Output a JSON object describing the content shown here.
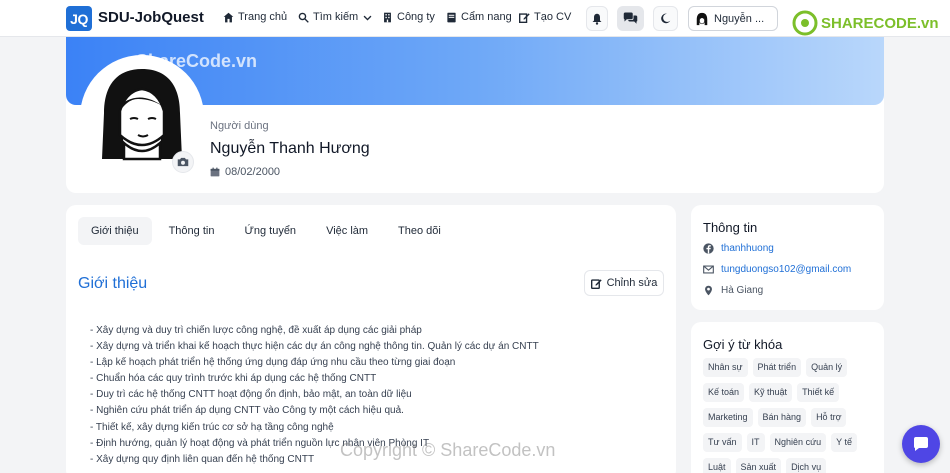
{
  "header": {
    "logo_text": "JQ",
    "brand": "SDU-JobQuest",
    "nav": [
      {
        "label": "Trang chủ",
        "icon": "home-icon"
      },
      {
        "label": "Tìm kiếm",
        "icon": "search-icon"
      },
      {
        "label": "Công ty",
        "icon": "building-icon"
      },
      {
        "label": "Cẩm nang",
        "icon": "book-icon"
      },
      {
        "label": "Tạo CV",
        "icon": "edit-icon"
      }
    ],
    "user_name": "Nguyễn ...",
    "watermark_logo": "SHARECODE.vn"
  },
  "profile": {
    "role": "Người dùng",
    "name": "Nguyễn Thanh Hương",
    "dob": "08/02/2000",
    "banner_watermark": "ShareCode.vn"
  },
  "tabs": [
    "Giới thiệu",
    "Thông tin",
    "Ứng tuyển",
    "Việc làm",
    "Theo dõi"
  ],
  "intro": {
    "title": "Giới thiệu",
    "edit_label": "Chỉnh sửa",
    "items": [
      "- Xây dựng và duy trì chiến lược công nghệ, đề xuất áp dụng các giải pháp",
      "- Xây dựng và triển khai kế hoạch thực hiện các dự án công nghệ thông tin. Quản lý các dự án CNTT",
      "- Lập kế hoạch phát triển hệ thống ứng dụng đáp ứng nhu cầu theo từng giai đoạn",
      "- Chuẩn hóa các quy trình trước khi áp dụng các hệ thống CNTT",
      "- Duy trì các hệ thống CNTT hoạt động ổn định, bảo mật, an toàn dữ liệu",
      "- Nghiên cứu phát triển áp dụng CNTT vào Công ty một cách hiệu quả.",
      "- Thiết kế, xây dựng kiến trúc cơ sở hạ tầng công nghệ",
      "- Định hướng, quản lý hoạt động và phát triển nguồn lực nhân viên Phòng IT",
      "- Xây dựng quy định liên quan đến hệ thống CNTT"
    ]
  },
  "info": {
    "title": "Thông tin",
    "facebook": "thanhhuong",
    "email": "tungduongso102@gmail.com",
    "location": "Hà Giang"
  },
  "keywords": {
    "title": "Gợi ý từ khóa",
    "items": [
      "Nhân sự",
      "Phát triển",
      "Quản lý",
      "Kế toán",
      "Kỹ thuật",
      "Thiết kế",
      "Marketing",
      "Bán hàng",
      "Hỗ trợ",
      "Tư vấn",
      "IT",
      "Nghiên cứu",
      "Y tế",
      "Luật",
      "Sản xuất",
      "Dịch vụ"
    ]
  },
  "watermark_bottom": "Copyright © ShareCode.vn",
  "colors": {
    "primary": "#1f6fd6",
    "chat": "#4f46e5",
    "banner_start": "#3b82f6",
    "banner_end": "#b9d7fb"
  }
}
